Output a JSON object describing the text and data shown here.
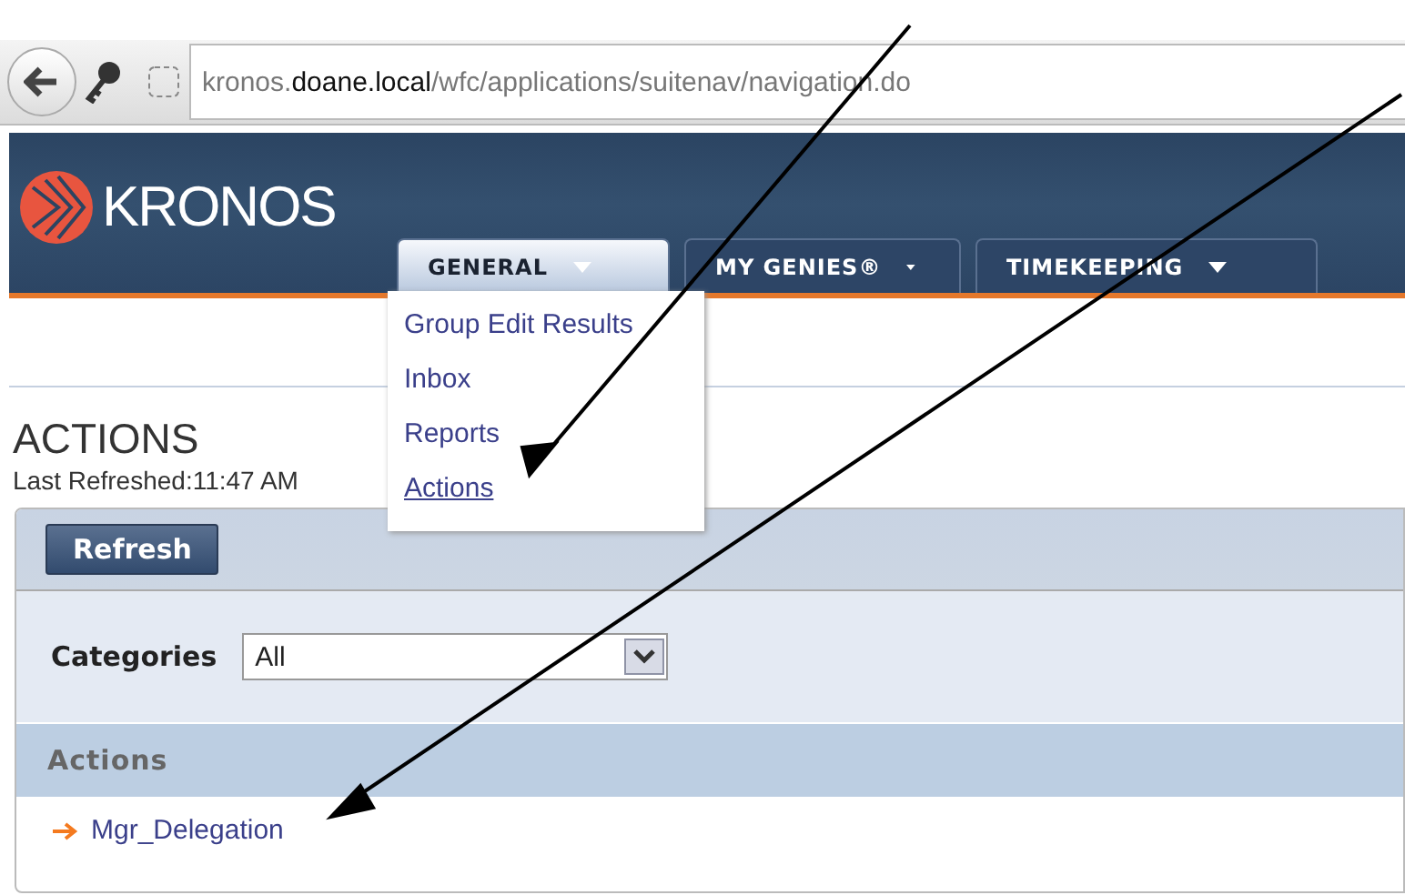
{
  "browser": {
    "url": "kronos.**doane.local**/wfc/applications/suitenav/navigation.do"
  },
  "header": {
    "logo": "KRONOS",
    "tabs": [
      {
        "label": "GENERAL",
        "selected": true
      },
      {
        "label": "MY GENIES®",
        "selected": false
      },
      {
        "label": "TIMEKEEPING",
        "selected": false
      }
    ]
  },
  "menu": {
    "items": [
      {
        "label": "Group Edit Results",
        "selected": false
      },
      {
        "label": "Inbox",
        "selected": false
      },
      {
        "label": "Reports",
        "selected": false
      },
      {
        "label": "Actions",
        "selected": true
      }
    ]
  },
  "page": {
    "title": "ACTIONS",
    "refreshed": "Last Refreshed:11:47 AM",
    "refresh_button": "Refresh",
    "categories_label": "Categories",
    "categories_value": "All",
    "section_title": "Actions",
    "actions": [
      "Mgr_Delegation"
    ]
  }
}
